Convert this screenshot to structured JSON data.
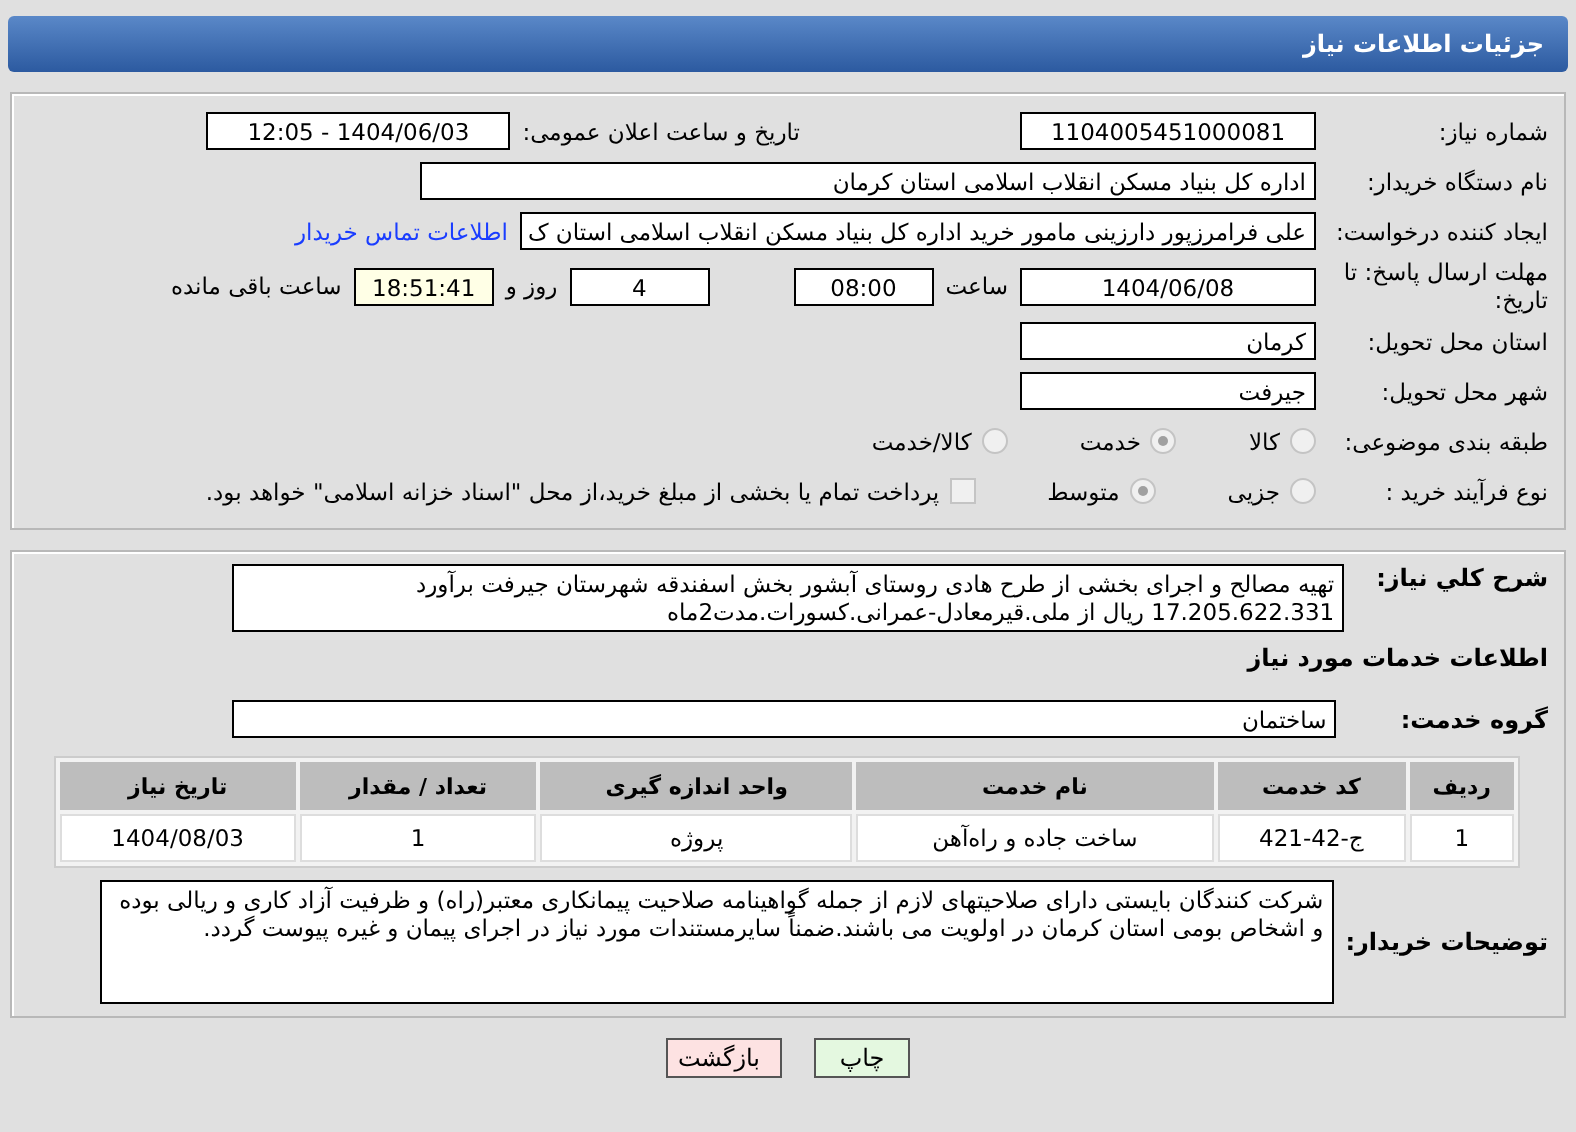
{
  "window": {
    "title": "جزئیات اطلاعات نیاز"
  },
  "need_number": {
    "label": "شماره نیاز:",
    "value": "1104005451000081"
  },
  "announce_date": {
    "label": "تاریخ و ساعت اعلان عمومی:",
    "value": "1404/06/03 - 12:05"
  },
  "buyer_org": {
    "label": "نام دستگاه خریدار:",
    "value": "اداره کل بنیاد مسکن انقلاب اسلامی استان کرمان"
  },
  "requester": {
    "label": "ایجاد کننده درخواست:",
    "value": "علی فرامرزپور دارزینی مامور خرید اداره کل بنیاد مسکن انقلاب اسلامی استان ک",
    "link": "اطلاعات تماس خریدار"
  },
  "deadline": {
    "label": "مهلت ارسال پاسخ: تا تاریخ:",
    "date": "1404/06/08",
    "time_label": "ساعت",
    "time": "08:00",
    "days": "4",
    "days_label": "روز و",
    "remaining": "18:51:41",
    "remaining_label": "ساعت باقی مانده"
  },
  "province": {
    "label": "استان محل تحویل:",
    "value": "کرمان"
  },
  "city": {
    "label": "شهر محل تحویل:",
    "value": "جیرفت"
  },
  "category": {
    "label": "طبقه بندی موضوعی:",
    "options": [
      {
        "label": "کالا",
        "selected": false
      },
      {
        "label": "خدمت",
        "selected": true
      },
      {
        "label": "کالا/خدمت",
        "selected": false
      }
    ]
  },
  "purchase_type": {
    "label": "نوع فرآیند خرید :",
    "options": [
      {
        "label": "جزیی",
        "selected": false
      },
      {
        "label": "متوسط",
        "selected": true
      }
    ],
    "payment": {
      "checked": false,
      "label": "پرداخت تمام یا بخشی از مبلغ خرید،از محل \"اسناد خزانه اسلامی\" خواهد بود."
    }
  },
  "summary": {
    "label": "شرح کلي نياز:",
    "value": "تهیه مصالح و اجرای بخشی از طرح هادی روستای آبشور بخش اسفندقه شهرستان جیرفت برآورد 17.205.622.331 ریال از ملی.قیرمعادل-عمرانی.کسورات.مدت2ماه"
  },
  "services_heading": "اطلاعات خدمات مورد نياز",
  "service_group": {
    "label": "گروه خدمت:",
    "value": "ساختمان"
  },
  "table": {
    "columns": [
      "ردیف",
      "کد خدمت",
      "نام خدمت",
      "واحد اندازه گیری",
      "تعداد / مقدار",
      "تاریخ نیاز"
    ],
    "rows": [
      [
        "1",
        "ج-42-421",
        "ساخت جاده و راه‌آهن",
        "پروژه",
        "1",
        "1404/08/03"
      ]
    ]
  },
  "buyer_notes": {
    "label": "توضیحات خریدار:",
    "value": "شرکت کنندگان بایستی دارای صلاحیتهای لازم از جمله گواهینامه صلاحیت پیمانکاری معتبر(راه) و ظرفیت آزاد کاری و ریالی بوده و اشخاص بومی استان کرمان در اولویت می باشند.ضمناً سایرمستندات مورد نیاز در اجرای پیمان و غیره پیوست گردد."
  },
  "buttons": [
    {
      "label": "چاپ",
      "kind": "print"
    },
    {
      "label": "بازگشت",
      "kind": "back"
    }
  ]
}
